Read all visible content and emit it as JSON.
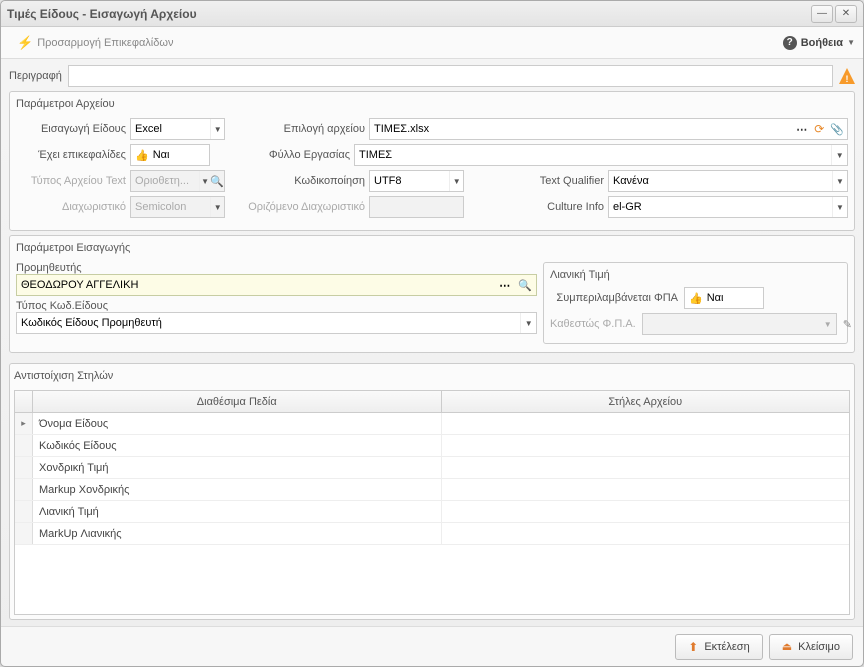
{
  "window": {
    "title": "Τιμές Είδους - Εισαγωγή Αρχείου"
  },
  "toolbar": {
    "customize_headers": "Προσαρμογή Επικεφαλίδων",
    "help": "Βοήθεια"
  },
  "desc": {
    "label": "Περιγραφή",
    "value": ""
  },
  "file_params": {
    "title": "Παράμετροι Αρχείου",
    "import_type_label": "Εισαγωγή Είδους",
    "import_type_value": "Excel",
    "file_select_label": "Επιλογή αρχείου",
    "file_select_value": "ΤΙΜΕΣ.xlsx",
    "has_headers_label": "Έχει επικεφαλίδες",
    "has_headers_value": "Ναι",
    "worksheet_label": "Φύλλο Εργασίας",
    "worksheet_value": "ΤΙΜΕΣ",
    "text_file_type_label": "Τύπος Αρχείου Text",
    "text_file_type_value": "Οριοθετη...",
    "encoding_label": "Κωδικοποίηση",
    "encoding_value": "UTF8",
    "text_qualifier_label": "Text Qualifier",
    "text_qualifier_value": "Κανένα",
    "delimiter_label": "Διαχωριστικό",
    "delimiter_value": "Semicolon",
    "custom_delim_label": "Οριζόμενο Διαχωριστικό",
    "custom_delim_value": "",
    "culture_label": "Culture Info",
    "culture_value": "el-GR"
  },
  "import_params": {
    "title": "Παράμετροι Εισαγωγής",
    "supplier_label": "Προμηθευτής",
    "supplier_value": "ΘΕΟΔΩΡΟΥ ΑΓΓΕΛΙΚΗ",
    "code_type_label": "Τύπος Κωδ.Είδους",
    "code_type_value": "Κωδικός Είδους Προμηθευτή",
    "retail_title": "Λιανική Τιμή",
    "vat_included_label": "Συμπεριλαμβάνεται ΦΠΑ",
    "vat_included_value": "Ναι",
    "vat_status_label": "Καθεστώς Φ.Π.Α.",
    "vat_status_value": ""
  },
  "mapping": {
    "title": "Αντιστοίχιση Στηλών",
    "available_col": "Διαθέσιμα Πεδία",
    "file_col": "Στήλες Αρχείου",
    "rows": [
      "Όνομα Είδους",
      "Κωδικός Είδους",
      "Χονδρική Τιμή",
      "Markup Χονδρικής",
      "Λιανική Τιμή",
      "MarkUp Λιανικής"
    ]
  },
  "footer": {
    "execute": "Εκτέλεση",
    "close": "Κλείσιμο"
  }
}
